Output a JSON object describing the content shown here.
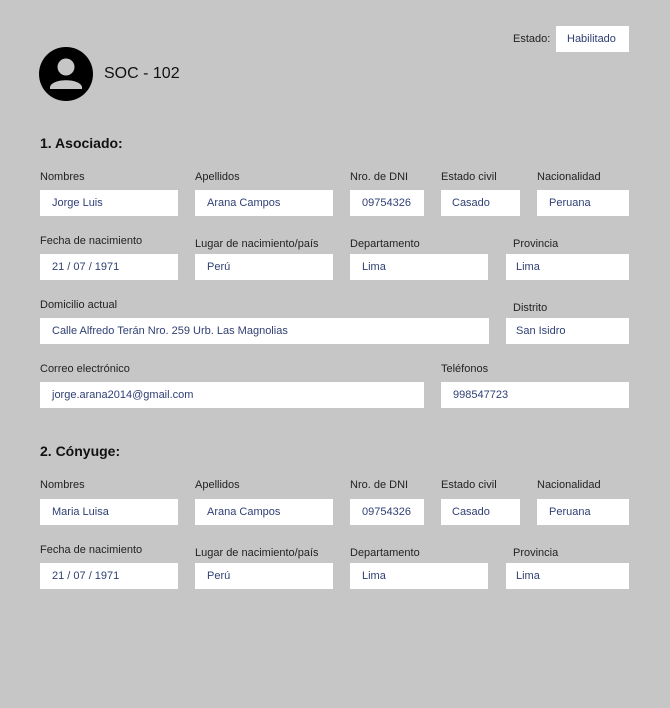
{
  "header": {
    "estado_label": "Estado:",
    "estado_value": "Habilitado",
    "code": "SOC - 102",
    "avatar_icon": "user-avatar-icon"
  },
  "asociado": {
    "title": "1. Asociado:",
    "labels": {
      "nombres": "Nombres",
      "apellidos": "Apellidos",
      "dni": "Nro. de DNI",
      "estado_civil": "Estado civil",
      "nacionalidad": "Nacionalidad",
      "fecha_nac": "Fecha de nacimiento",
      "lugar_nac": "Lugar de nacimiento/país",
      "departamento": "Departamento",
      "provincia": "Provincia",
      "domicilio": "Domicilio actual",
      "distrito": "Distrito",
      "correo": "Correo electrónico",
      "telefonos": "Teléfonos"
    },
    "values": {
      "nombres": "Jorge Luis",
      "apellidos": "Arana Campos",
      "dni": "09754326",
      "estado_civil": "Casado",
      "nacionalidad": "Peruana",
      "fecha_nac": "21 / 07 / 1971",
      "lugar_nac": "Perú",
      "departamento": "Lima",
      "provincia": "Lima",
      "domicilio": "Calle Alfredo Terán Nro. 259 Urb. Las Magnolias",
      "distrito": "San Isidro",
      "correo": "jorge.arana2014@gmail.com",
      "telefonos": "998547723"
    }
  },
  "conyuge": {
    "title": "2. Cónyuge:",
    "labels": {
      "nombres": "Nombres",
      "apellidos": "Apellidos",
      "dni": "Nro. de DNI",
      "estado_civil": "Estado civil",
      "nacionalidad": "Nacionalidad",
      "fecha_nac": "Fecha de nacimiento",
      "lugar_nac": "Lugar de nacimiento/país",
      "departamento": "Departamento",
      "provincia": "Provincia"
    },
    "values": {
      "nombres": "Maria Luisa",
      "apellidos": "Arana Campos",
      "dni": "09754326",
      "estado_civil": "Casado",
      "nacionalidad": "Peruana",
      "fecha_nac": "21 / 07 / 1971",
      "lugar_nac": "Perú",
      "departamento": "Lima",
      "provincia": "Lima"
    }
  }
}
